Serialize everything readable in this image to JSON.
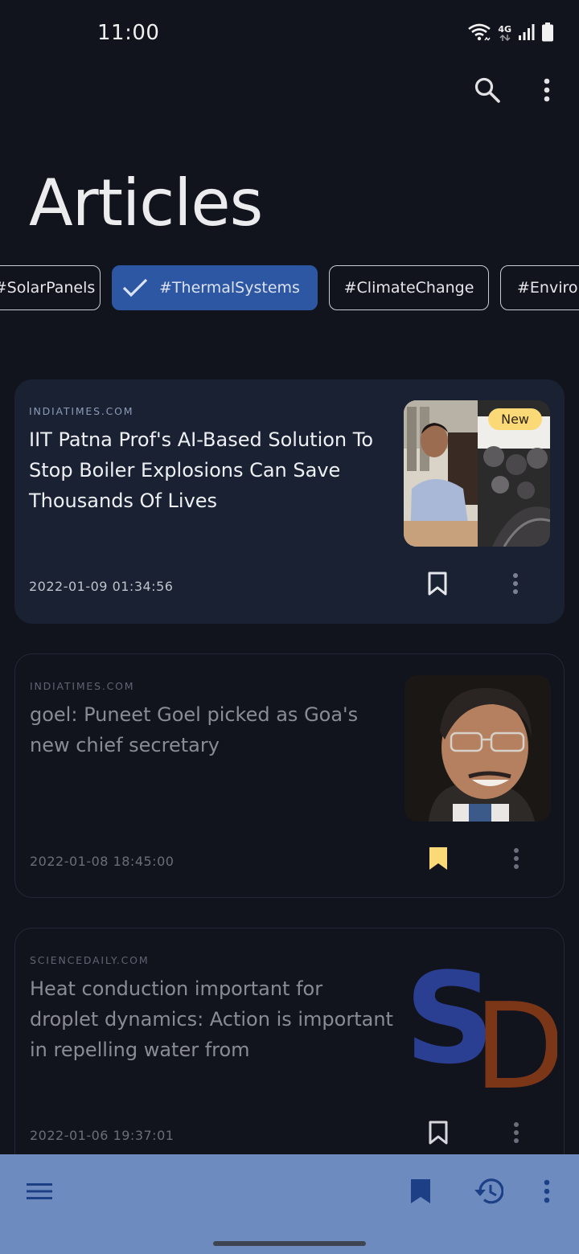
{
  "status_bar": {
    "time": "11:00",
    "network_label": "4G",
    "icons": [
      "wifi-icon",
      "network-4g-icon",
      "signal-icon",
      "battery-icon"
    ]
  },
  "top_bar": {
    "icons": [
      "search-icon",
      "more-vert-icon"
    ]
  },
  "page": {
    "title": "Articles"
  },
  "chips": [
    {
      "label": "#SolarPanels",
      "selected": false
    },
    {
      "label": "#ThermalSystems",
      "selected": true
    },
    {
      "label": "#ClimateChange",
      "selected": false
    },
    {
      "label": "#Environment",
      "selected": false
    }
  ],
  "articles": [
    {
      "source": "INDIATIMES.COM",
      "title": "IIT Patna Prof's AI-Based Solution To Stop Boiler Explosions Can Save Thousands Of Lives",
      "date": "2022-01-09 01:34:56",
      "badge": "New",
      "bookmarked": false,
      "read": false
    },
    {
      "source": "INDIATIMES.COM",
      "title": "goel: Puneet Goel picked as Goa's new chief secretary",
      "date": "2022-01-08 18:45:00",
      "bookmarked": true,
      "read": true
    },
    {
      "source": "SCIENCEDAILY.COM",
      "title": "Heat conduction important for droplet dynamics: Action is important in repelling water from",
      "date": "2022-01-06 19:37:01",
      "thumb_text": [
        "S",
        "D"
      ],
      "bookmarked": false,
      "read": true
    }
  ],
  "bottom_bar": {
    "icons": [
      "menu-icon",
      "bookmarks-icon",
      "history-icon",
      "more-vert-icon"
    ]
  },
  "colors": {
    "background": "#12141d",
    "card_filled": "#192132",
    "chip_selected": "#2d57a3",
    "badge": "#fbd977",
    "bookmark_active": "#fbd977",
    "bottom_bar": "#6e8bc0",
    "bottom_icons": "#1c3f86"
  }
}
